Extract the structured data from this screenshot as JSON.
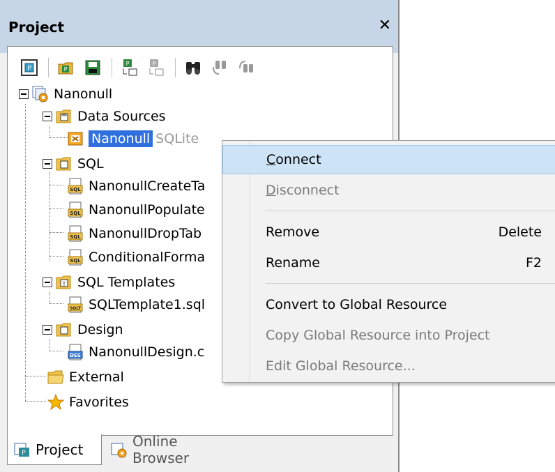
{
  "panel": {
    "title": "Project",
    "close_glyph": "✕"
  },
  "toolbar": {
    "buttons": [
      {
        "icon": "new-project-icon"
      },
      {
        "icon": "open-project-icon"
      },
      {
        "icon": "save-project-icon"
      },
      {
        "icon": "add-to-project-icon"
      },
      {
        "icon": "remove-from-project-icon"
      },
      {
        "icon": "find-icon"
      },
      {
        "icon": "find-next-icon"
      },
      {
        "icon": "find-previous-icon"
      }
    ]
  },
  "tree": {
    "root": "Nanonull",
    "data_sources": {
      "label": "Data Sources",
      "items": [
        {
          "label": "Nanonull",
          "type": "SQLite"
        }
      ]
    },
    "sql": {
      "label": "SQL",
      "items": [
        "NanonullCreateTa",
        "NanonullPopulate",
        "NanonullDropTab",
        "ConditionalForma"
      ]
    },
    "sql_templates": {
      "label": "SQL Templates",
      "items": [
        "SQLTemplate1.sql"
      ]
    },
    "design": {
      "label": "Design",
      "items": [
        "NanonullDesign.c"
      ]
    },
    "external": "External",
    "favorites": "Favorites"
  },
  "tabs": [
    {
      "label": "Project",
      "active": true
    },
    {
      "label": "Online Browser",
      "active": false
    }
  ],
  "context_menu": {
    "connect": {
      "label": "onnect",
      "accel": "C"
    },
    "disconnect": {
      "label": "isconnect",
      "accel": "D"
    },
    "remove": {
      "label": "Remove",
      "key": "Delete"
    },
    "rename": {
      "label": "Rename",
      "key": "F2"
    },
    "convert": {
      "label": "Convert to Global Resource"
    },
    "copy_global": {
      "label": "Copy Global Resource into Project"
    },
    "edit_global": {
      "label": "Edit Global Resource..."
    }
  },
  "colors": {
    "titlebar": "#c7d6e6",
    "selection": "#2f6fde",
    "menu_highlight": "#cde4f7",
    "folder": "#f0c14b",
    "star": "#f5b800"
  }
}
